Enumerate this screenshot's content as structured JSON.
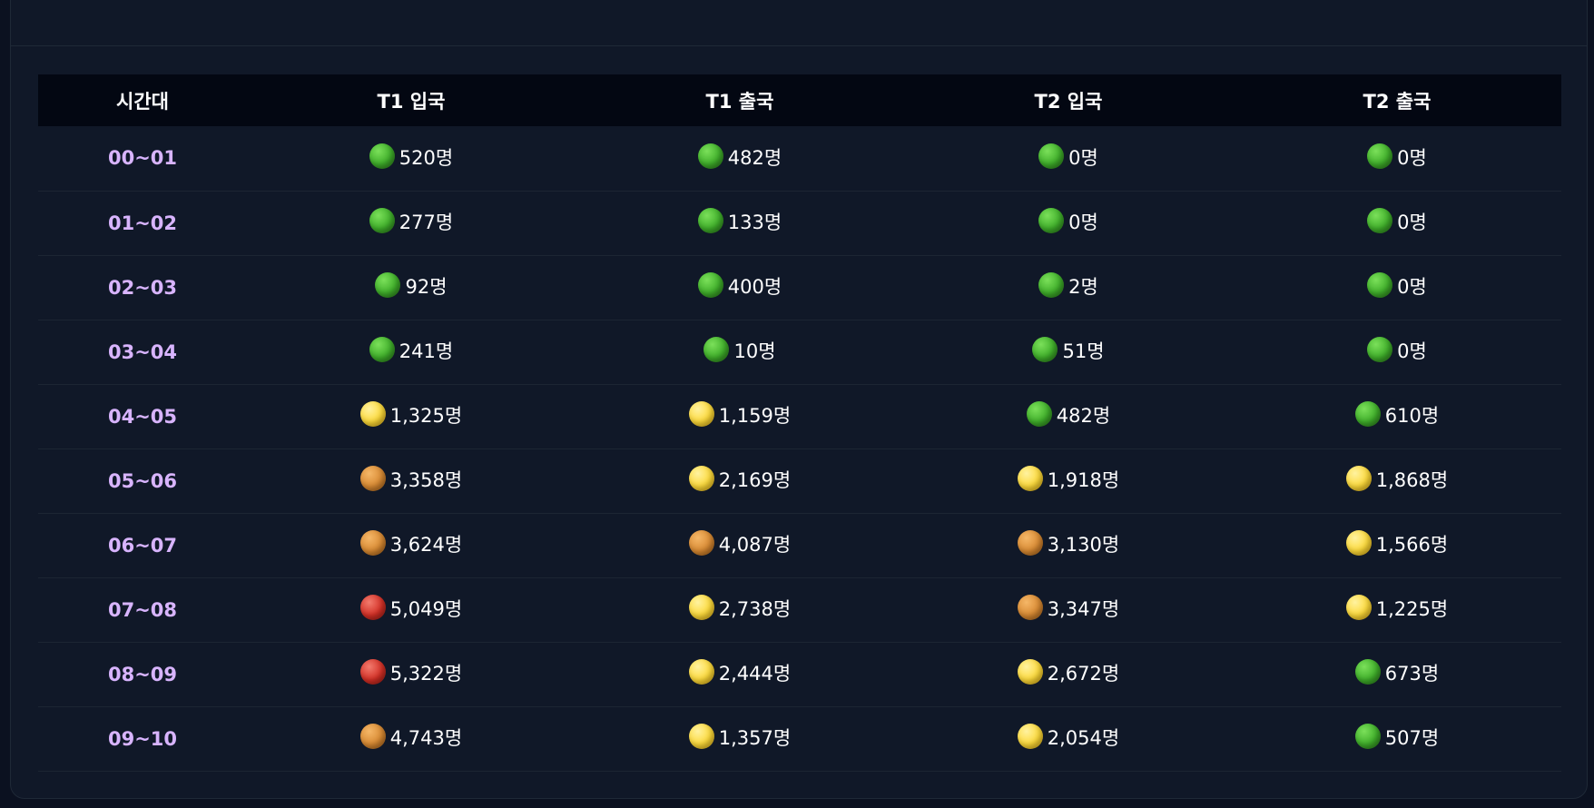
{
  "table": {
    "headers": [
      "시간대",
      "T1 입국",
      "T1 출국",
      "T2 입국",
      "T2 출국"
    ],
    "level_colors": {
      "green": "#3fae2a",
      "yellow": "#fcd93a",
      "orange": "#d88a33",
      "red": "#d33026"
    },
    "rows": [
      {
        "time": "00~01",
        "cells": [
          {
            "level": "green",
            "icon": "green-circle-icon",
            "value": "520명"
          },
          {
            "level": "green",
            "icon": "green-circle-icon",
            "value": "482명"
          },
          {
            "level": "green",
            "icon": "green-circle-icon",
            "value": "0명"
          },
          {
            "level": "green",
            "icon": "green-circle-icon",
            "value": "0명"
          }
        ]
      },
      {
        "time": "01~02",
        "cells": [
          {
            "level": "green",
            "icon": "green-circle-icon",
            "value": "277명"
          },
          {
            "level": "green",
            "icon": "green-circle-icon",
            "value": "133명"
          },
          {
            "level": "green",
            "icon": "green-circle-icon",
            "value": "0명"
          },
          {
            "level": "green",
            "icon": "green-circle-icon",
            "value": "0명"
          }
        ]
      },
      {
        "time": "02~03",
        "cells": [
          {
            "level": "green",
            "icon": "green-circle-icon",
            "value": "92명"
          },
          {
            "level": "green",
            "icon": "green-circle-icon",
            "value": "400명"
          },
          {
            "level": "green",
            "icon": "green-circle-icon",
            "value": "2명"
          },
          {
            "level": "green",
            "icon": "green-circle-icon",
            "value": "0명"
          }
        ]
      },
      {
        "time": "03~04",
        "cells": [
          {
            "level": "green",
            "icon": "green-circle-icon",
            "value": "241명"
          },
          {
            "level": "green",
            "icon": "green-circle-icon",
            "value": "10명"
          },
          {
            "level": "green",
            "icon": "green-circle-icon",
            "value": "51명"
          },
          {
            "level": "green",
            "icon": "green-circle-icon",
            "value": "0명"
          }
        ]
      },
      {
        "time": "04~05",
        "cells": [
          {
            "level": "yellow",
            "icon": "yellow-circle-icon",
            "value": "1,325명"
          },
          {
            "level": "yellow",
            "icon": "yellow-circle-icon",
            "value": "1,159명"
          },
          {
            "level": "green",
            "icon": "green-circle-icon",
            "value": "482명"
          },
          {
            "level": "green",
            "icon": "green-circle-icon",
            "value": "610명"
          }
        ]
      },
      {
        "time": "05~06",
        "cells": [
          {
            "level": "orange",
            "icon": "orange-circle-icon",
            "value": "3,358명"
          },
          {
            "level": "yellow",
            "icon": "yellow-circle-icon",
            "value": "2,169명"
          },
          {
            "level": "yellow",
            "icon": "yellow-circle-icon",
            "value": "1,918명"
          },
          {
            "level": "yellow",
            "icon": "yellow-circle-icon",
            "value": "1,868명"
          }
        ]
      },
      {
        "time": "06~07",
        "cells": [
          {
            "level": "orange",
            "icon": "orange-circle-icon",
            "value": "3,624명"
          },
          {
            "level": "orange",
            "icon": "orange-circle-icon",
            "value": "4,087명"
          },
          {
            "level": "orange",
            "icon": "orange-circle-icon",
            "value": "3,130명"
          },
          {
            "level": "yellow",
            "icon": "yellow-circle-icon",
            "value": "1,566명"
          }
        ]
      },
      {
        "time": "07~08",
        "cells": [
          {
            "level": "red",
            "icon": "red-circle-icon",
            "value": "5,049명"
          },
          {
            "level": "yellow",
            "icon": "yellow-circle-icon",
            "value": "2,738명"
          },
          {
            "level": "orange",
            "icon": "orange-circle-icon",
            "value": "3,347명"
          },
          {
            "level": "yellow",
            "icon": "yellow-circle-icon",
            "value": "1,225명"
          }
        ]
      },
      {
        "time": "08~09",
        "cells": [
          {
            "level": "red",
            "icon": "red-circle-icon",
            "value": "5,322명"
          },
          {
            "level": "yellow",
            "icon": "yellow-circle-icon",
            "value": "2,444명"
          },
          {
            "level": "yellow",
            "icon": "yellow-circle-icon",
            "value": "2,672명"
          },
          {
            "level": "green",
            "icon": "green-circle-icon",
            "value": "673명"
          }
        ]
      },
      {
        "time": "09~10",
        "cells": [
          {
            "level": "orange",
            "icon": "orange-circle-icon",
            "value": "4,743명"
          },
          {
            "level": "yellow",
            "icon": "yellow-circle-icon",
            "value": "1,357명"
          },
          {
            "level": "yellow",
            "icon": "yellow-circle-icon",
            "value": "2,054명"
          },
          {
            "level": "green",
            "icon": "green-circle-icon",
            "value": "507명"
          }
        ]
      }
    ]
  }
}
